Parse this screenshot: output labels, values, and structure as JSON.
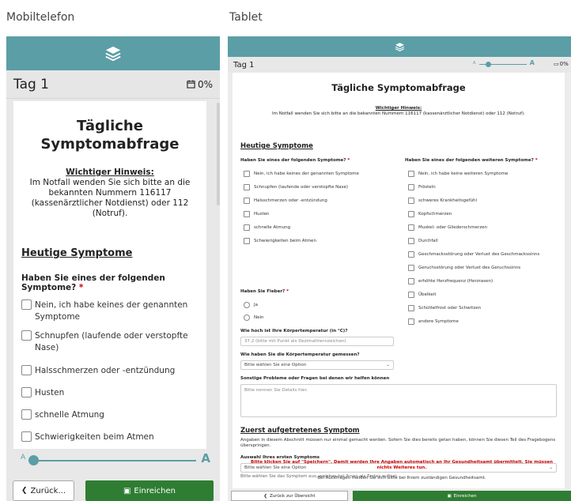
{
  "captions": {
    "mobile": "Mobiltelefon",
    "tablet": "Tablet"
  },
  "colors": {
    "teal": "#5b9ea6",
    "green": "#2e7d32",
    "required": "#cc0000"
  },
  "mobile": {
    "day": "Tag 1",
    "percent": "0%",
    "title": "Tägliche Symptomabfrage",
    "warning_heading": "Wichtiger Hinweis:",
    "warning_text": "Im Notfall wenden Sie sich bitte an die bekannten Nummern 116117 (kassenärztlicher Notdienst) oder 112 (Notruf).",
    "section": "Heutige Symptome",
    "question": "Haben Sie eines der folgenden Symptome?",
    "required_mark": "*",
    "options": [
      "Nein, ich habe keines der genannten Symptome",
      "Schnupfen (laufende oder verstopfte Nase)",
      "Halsschmerzen oder -entzündung",
      "Husten",
      "schnelle Atmung",
      "Schwierigkeiten beim Atmen"
    ],
    "font_small": "A",
    "font_large": "A",
    "back_label": "Zurück...",
    "submit_label": "Einreichen"
  },
  "tablet": {
    "day": "Tag 1",
    "percent": "0%",
    "font_small": "A",
    "font_large": "A",
    "title": "Tägliche Symptomabfrage",
    "warning_heading": "Wichtiger Hinweis:",
    "warning_text": "Im Notfall wenden Sie sich bitte an die bekannten Nummern 116117 (kassenärztlicher Notdienst) oder 112 (Notruf).",
    "section1": "Heutige Symptome",
    "q1": "Haben Sie eines der folgenden Symptome?",
    "q1_options": [
      "Nein, ich habe keines der genannten Symptome",
      "Schnupfen (laufende oder verstopfte Nase)",
      "Halsschmerzen oder -entzündung",
      "Husten",
      "schnelle Atmung",
      "Schwierigkeiten beim Atmen"
    ],
    "q2": "Haben Sie eines der folgenden weiteren Symptome?",
    "q2_options": [
      "Nein, ich habe keine weiteren Symptome",
      "Frösteln",
      "schweres Krankheitsgefühl",
      "Kopfschmerzen",
      "Muskel- oder Gliederschmerzen",
      "Durchfall",
      "Geschmacksstörung oder Verlust des Geschmackssinns",
      "Geruchsstörung oder Verlust des Geruchssinns",
      "erhöhte Herzfrequenz (Herzrasen)",
      "Übelkeit",
      "Schüttelfrost oder Schwitzen",
      "andere Symptome"
    ],
    "q_fever": "Haben Sie Fieber?",
    "fever_options": [
      "Ja",
      "Nein"
    ],
    "q_temp": "Wie hoch ist Ihre Körpertemperatur (in °C)?",
    "temp_placeholder": "37.2 (bitte mit Punkt als Dezimaltrennzeichen)",
    "q_method": "Wie haben Sie die Körpertemperatur gemessen?",
    "method_select": "Bitte wählen Sie eine Option",
    "q_other": "Sonstige Probleme oder Fragen bei denen wir helfen können",
    "other_placeholder": "Bitte nennen Sie Details hier.",
    "section2": "Zuerst aufgetretenes Symptom",
    "section2_text": "Angaben in diesem Abschnitt müssen nur einmal gemacht werden. Sofern Sie dies bereits getan haben, können Sie diesen Teil des Fragebogens überspringen.",
    "q_first": "Auswahl Ihres ersten Symptoms",
    "first_select": "Bitte wählen Sie eine Option",
    "first_help": "Bitte wählen Sie das Symptom aus, welches bei Ihnen als Erstes auftrat.",
    "save_notice": "Bitte klicken Sie auf \"Speichern\". Damit werden Ihre Angaben automatisch an Ihr Gesundheitsamt übermittelt. Sie müssen nichts Weiteres tun.",
    "contact_notice": "Bei Rückfragen melden Sie sich bitte bei Ihrem zuständigen Gesundheitsamt.",
    "back_label": "Zurück zur Übersicht",
    "submit_label": "Einreichen"
  }
}
